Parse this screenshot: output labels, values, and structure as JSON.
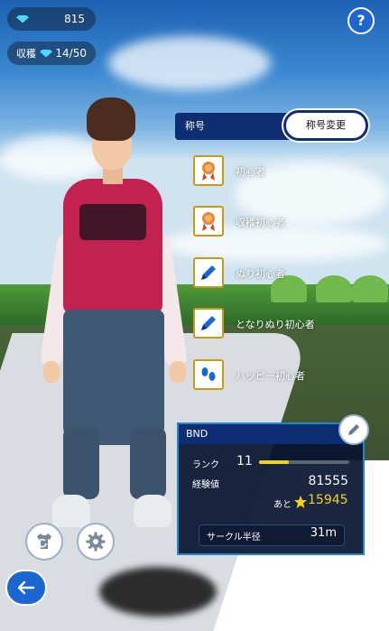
{
  "hud": {
    "gems": "815",
    "harvest_label": "収穫",
    "harvest_value": "14/50",
    "help_label": "?"
  },
  "titles": {
    "header": "称号",
    "change_button": "称号変更",
    "items": [
      {
        "label": "初心者",
        "icon": "medal-icon"
      },
      {
        "label": "収穫初心者",
        "icon": "medal-icon"
      },
      {
        "label": "ぬり初心者",
        "icon": "pen-icon"
      },
      {
        "label": "となりぬり初心者",
        "icon": "pen-icon"
      },
      {
        "label": "ハッピー初心者",
        "icon": "footprints-icon"
      }
    ]
  },
  "profile": {
    "name": "BND",
    "rank_label": "ランク",
    "rank_value": "11",
    "xp_label": "経験値",
    "xp_value": "81555",
    "remaining_prefix": "あと",
    "remaining_value": "15945",
    "rank_progress": 0.33,
    "circle_radius_label": "サークル半径",
    "circle_radius_value": "31m"
  },
  "colors": {
    "accent_blue": "#1b66d0",
    "navy": "#0f2d72",
    "gold": "#f1d21a",
    "gem": "#4fd8ff"
  }
}
